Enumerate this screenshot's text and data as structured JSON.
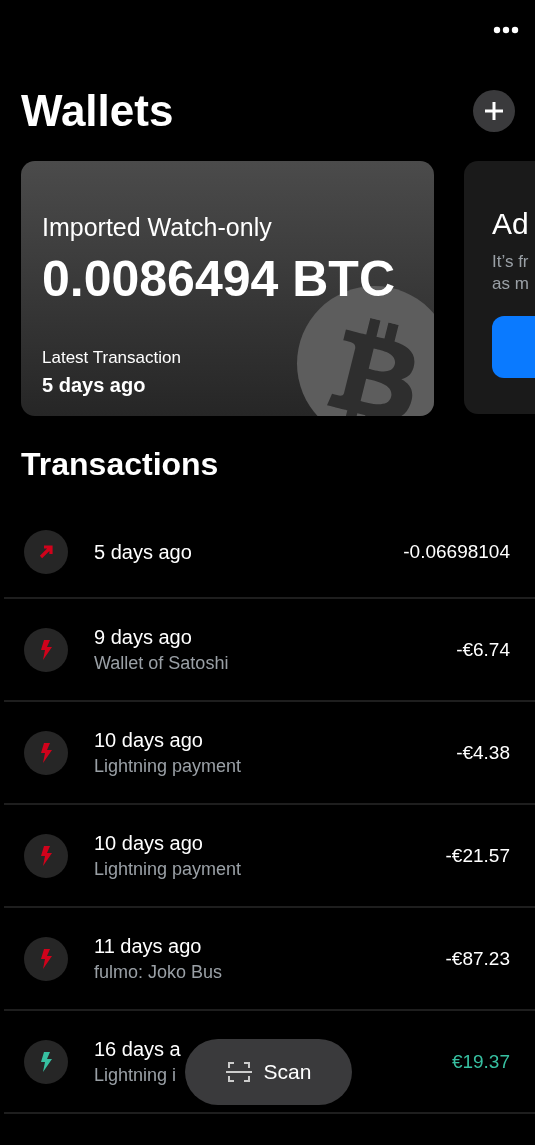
{
  "header": {
    "title": "Wallets"
  },
  "wallets": [
    {
      "kind": "wallet",
      "type_label": "Imported Watch-only",
      "balance": "0.0086494 BTC",
      "latest_label": "Latest Transaction",
      "latest_value": "5 days ago"
    },
    {
      "kind": "promo",
      "title": "Ad",
      "text_lines": [
        "It’s fr",
        "as m"
      ]
    }
  ],
  "transactions_title": "Transactions",
  "transactions": [
    {
      "kind": "onchain",
      "incoming": false,
      "date": "5 days ago",
      "amount": "-0.06698104"
    },
    {
      "kind": "lightning",
      "incoming": false,
      "date": "9 days ago",
      "memo": "Wallet of Satoshi",
      "amount": "-€6.74"
    },
    {
      "kind": "lightning",
      "incoming": false,
      "date": "10 days ago",
      "memo": "Lightning payment",
      "amount": "-€4.38"
    },
    {
      "kind": "lightning",
      "incoming": false,
      "date": "10 days ago",
      "memo": "Lightning payment",
      "amount": "-€21.57"
    },
    {
      "kind": "lightning",
      "incoming": false,
      "date": "11 days ago",
      "memo": "fulmo:  Joko Bus",
      "amount": "-€87.23"
    },
    {
      "kind": "lightning",
      "incoming": true,
      "date": "16 days a",
      "memo": "Lightning i",
      "amount": "€19.37"
    }
  ],
  "scan_button": {
    "label": "Scan"
  }
}
